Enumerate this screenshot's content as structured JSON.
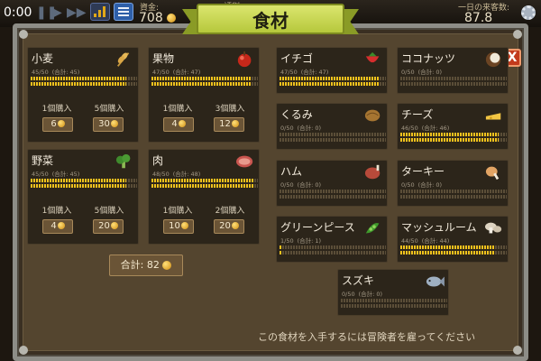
{
  "hud": {
    "time": "0:00",
    "money_label": "資金:",
    "money_value": "708",
    "fame_label": "評判:",
    "visitors_label": "一日の来客数:",
    "visitors_value": "87.8"
  },
  "dialog": {
    "title": "食材",
    "close_label": "X",
    "total_label": "合計: 82",
    "footer": "この食材を入手するには冒険者を雇ってください"
  },
  "buy_panels": [
    {
      "name": "小麦",
      "stock": "45/50",
      "total": "(合計: 45)",
      "level": 0.9,
      "icon": "wheat-icon",
      "opt1_label": "1個購入",
      "opt1_price": "6",
      "opt2_label": "5個購入",
      "opt2_price": "30"
    },
    {
      "name": "果物",
      "stock": "47/50",
      "total": "(合計: 47)",
      "level": 0.94,
      "icon": "apple-icon",
      "opt1_label": "1個購入",
      "opt1_price": "4",
      "opt2_label": "3個購入",
      "opt2_price": "12"
    },
    {
      "name": "野菜",
      "stock": "45/50",
      "total": "(合計: 45)",
      "level": 0.9,
      "icon": "broccoli-icon",
      "opt1_label": "1個購入",
      "opt1_price": "4",
      "opt2_label": "5個購入",
      "opt2_price": "20"
    },
    {
      "name": "肉",
      "stock": "48/50",
      "total": "(合計: 48)",
      "level": 0.96,
      "icon": "meat-icon",
      "opt1_label": "1個購入",
      "opt1_price": "10",
      "opt2_label": "2個購入",
      "opt2_price": "20"
    }
  ],
  "ingredients": [
    {
      "name": "イチゴ",
      "stock": "47/50",
      "total": "(合計: 47)",
      "level": 0.94,
      "icon": "strawberry-icon"
    },
    {
      "name": "ココナッツ",
      "stock": "0/50",
      "total": "(合計: 0)",
      "level": 0,
      "icon": "coconut-icon"
    },
    {
      "name": "くるみ",
      "stock": "0/50",
      "total": "(合計: 0)",
      "level": 0,
      "icon": "walnut-icon"
    },
    {
      "name": "チーズ",
      "stock": "46/50",
      "total": "(合計: 46)",
      "level": 0.92,
      "icon": "cheese-icon"
    },
    {
      "name": "ハム",
      "stock": "0/50",
      "total": "(合計: 0)",
      "level": 0,
      "icon": "ham-icon"
    },
    {
      "name": "ターキー",
      "stock": "0/50",
      "total": "(合計: 0)",
      "level": 0,
      "icon": "turkey-icon"
    },
    {
      "name": "グリーンピース",
      "stock": "1/50",
      "total": "(合計: 1)",
      "level": 0.02,
      "icon": "peas-icon"
    },
    {
      "name": "マッシュルーム",
      "stock": "44/50",
      "total": "(合計: 44)",
      "level": 0.88,
      "icon": "mushroom-icon"
    },
    {
      "name": "スズキ",
      "stock": "0/50",
      "total": "(合計: 0)",
      "level": 0,
      "icon": "fish-icon"
    }
  ],
  "colors": {
    "bar_fill": "#f2c21d",
    "bar_empty": "#5b4e38",
    "ribbon": "#c8d74e",
    "close": "#c23a1d"
  }
}
